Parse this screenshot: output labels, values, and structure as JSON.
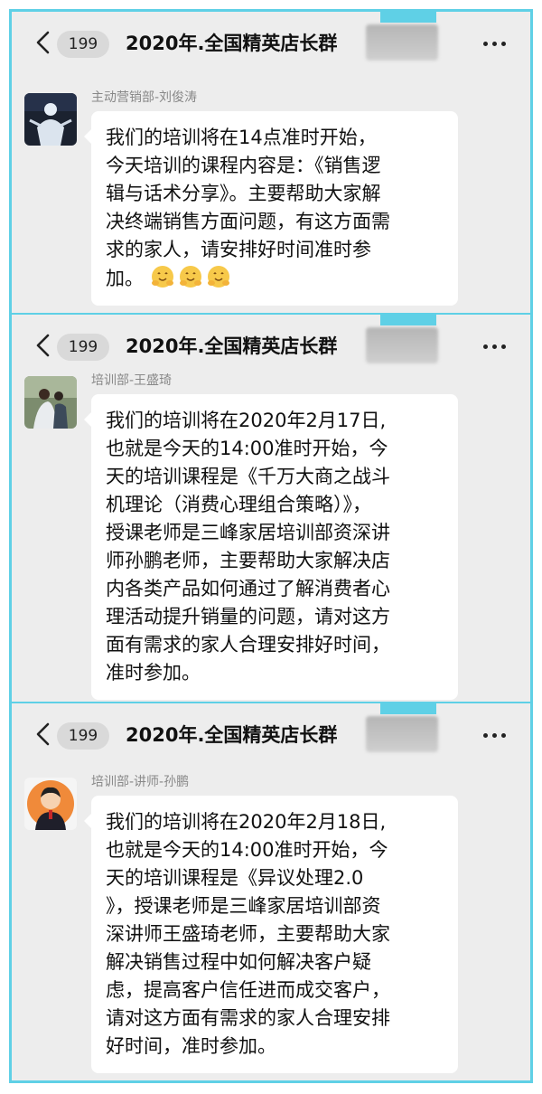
{
  "panels": [
    {
      "badge": "199",
      "title": "2020年.全国精英店长群",
      "sender": "主动营销部-刘俊涛",
      "lines": [
        "我们的培训将在14点准时开始，",
        "今天培训的课程内容是：《销售逻",
        "辑与话术分享》。主要帮助大家解",
        "决终端销售方面问题，有这方面需",
        "求的家人，请安排好时间准时参",
        "加。"
      ],
      "emojis": [
        "hugging-face",
        "hugging-face",
        "hugging-face"
      ]
    },
    {
      "badge": "199",
      "title": "2020年.全国精英店长群",
      "sender": "培训部-王盛琦",
      "lines": [
        "我们的培训将在2020年2月17日,",
        "也就是今天的14:00准时开始，今",
        "天的培训课程是《千万大商之战斗",
        "机理论（消费心理组合策略）》，",
        "授课老师是三峰家居培训部资深讲",
        "师孙鹏老师，主要帮助大家解决店",
        "内各类产品如何通过了解消费者心",
        "理活动提升销量的问题，请对这方",
        "面有需求的家人合理安排好时间，",
        "准时参加。"
      ]
    },
    {
      "badge": "199",
      "title": "2020年.全国精英店长群",
      "sender": "培训部-讲师-孙鹏",
      "lines": [
        "我们的培训将在2020年2月18日,",
        "也就是今天的14:00准时开始，今",
        "天的培训课程是《异议处理2.0",
        "》，授课老师是三峰家居培训部资",
        "深讲师王盛琦老师，主要帮助大家",
        "解决销售过程中如何解决客户疑",
        "虑，提高客户信任进而成交客户，",
        "请对这方面有需求的家人合理安排",
        "好时间，准时参加。"
      ]
    }
  ],
  "colors": {
    "frame": "#5fd0e6",
    "chat_bg": "#ededed",
    "bubble": "#ffffff",
    "badge_bg": "#d9d9d9",
    "sender_text": "#888888"
  },
  "icons": {
    "back": "chevron-left-icon",
    "more": "more-dots-icon"
  }
}
